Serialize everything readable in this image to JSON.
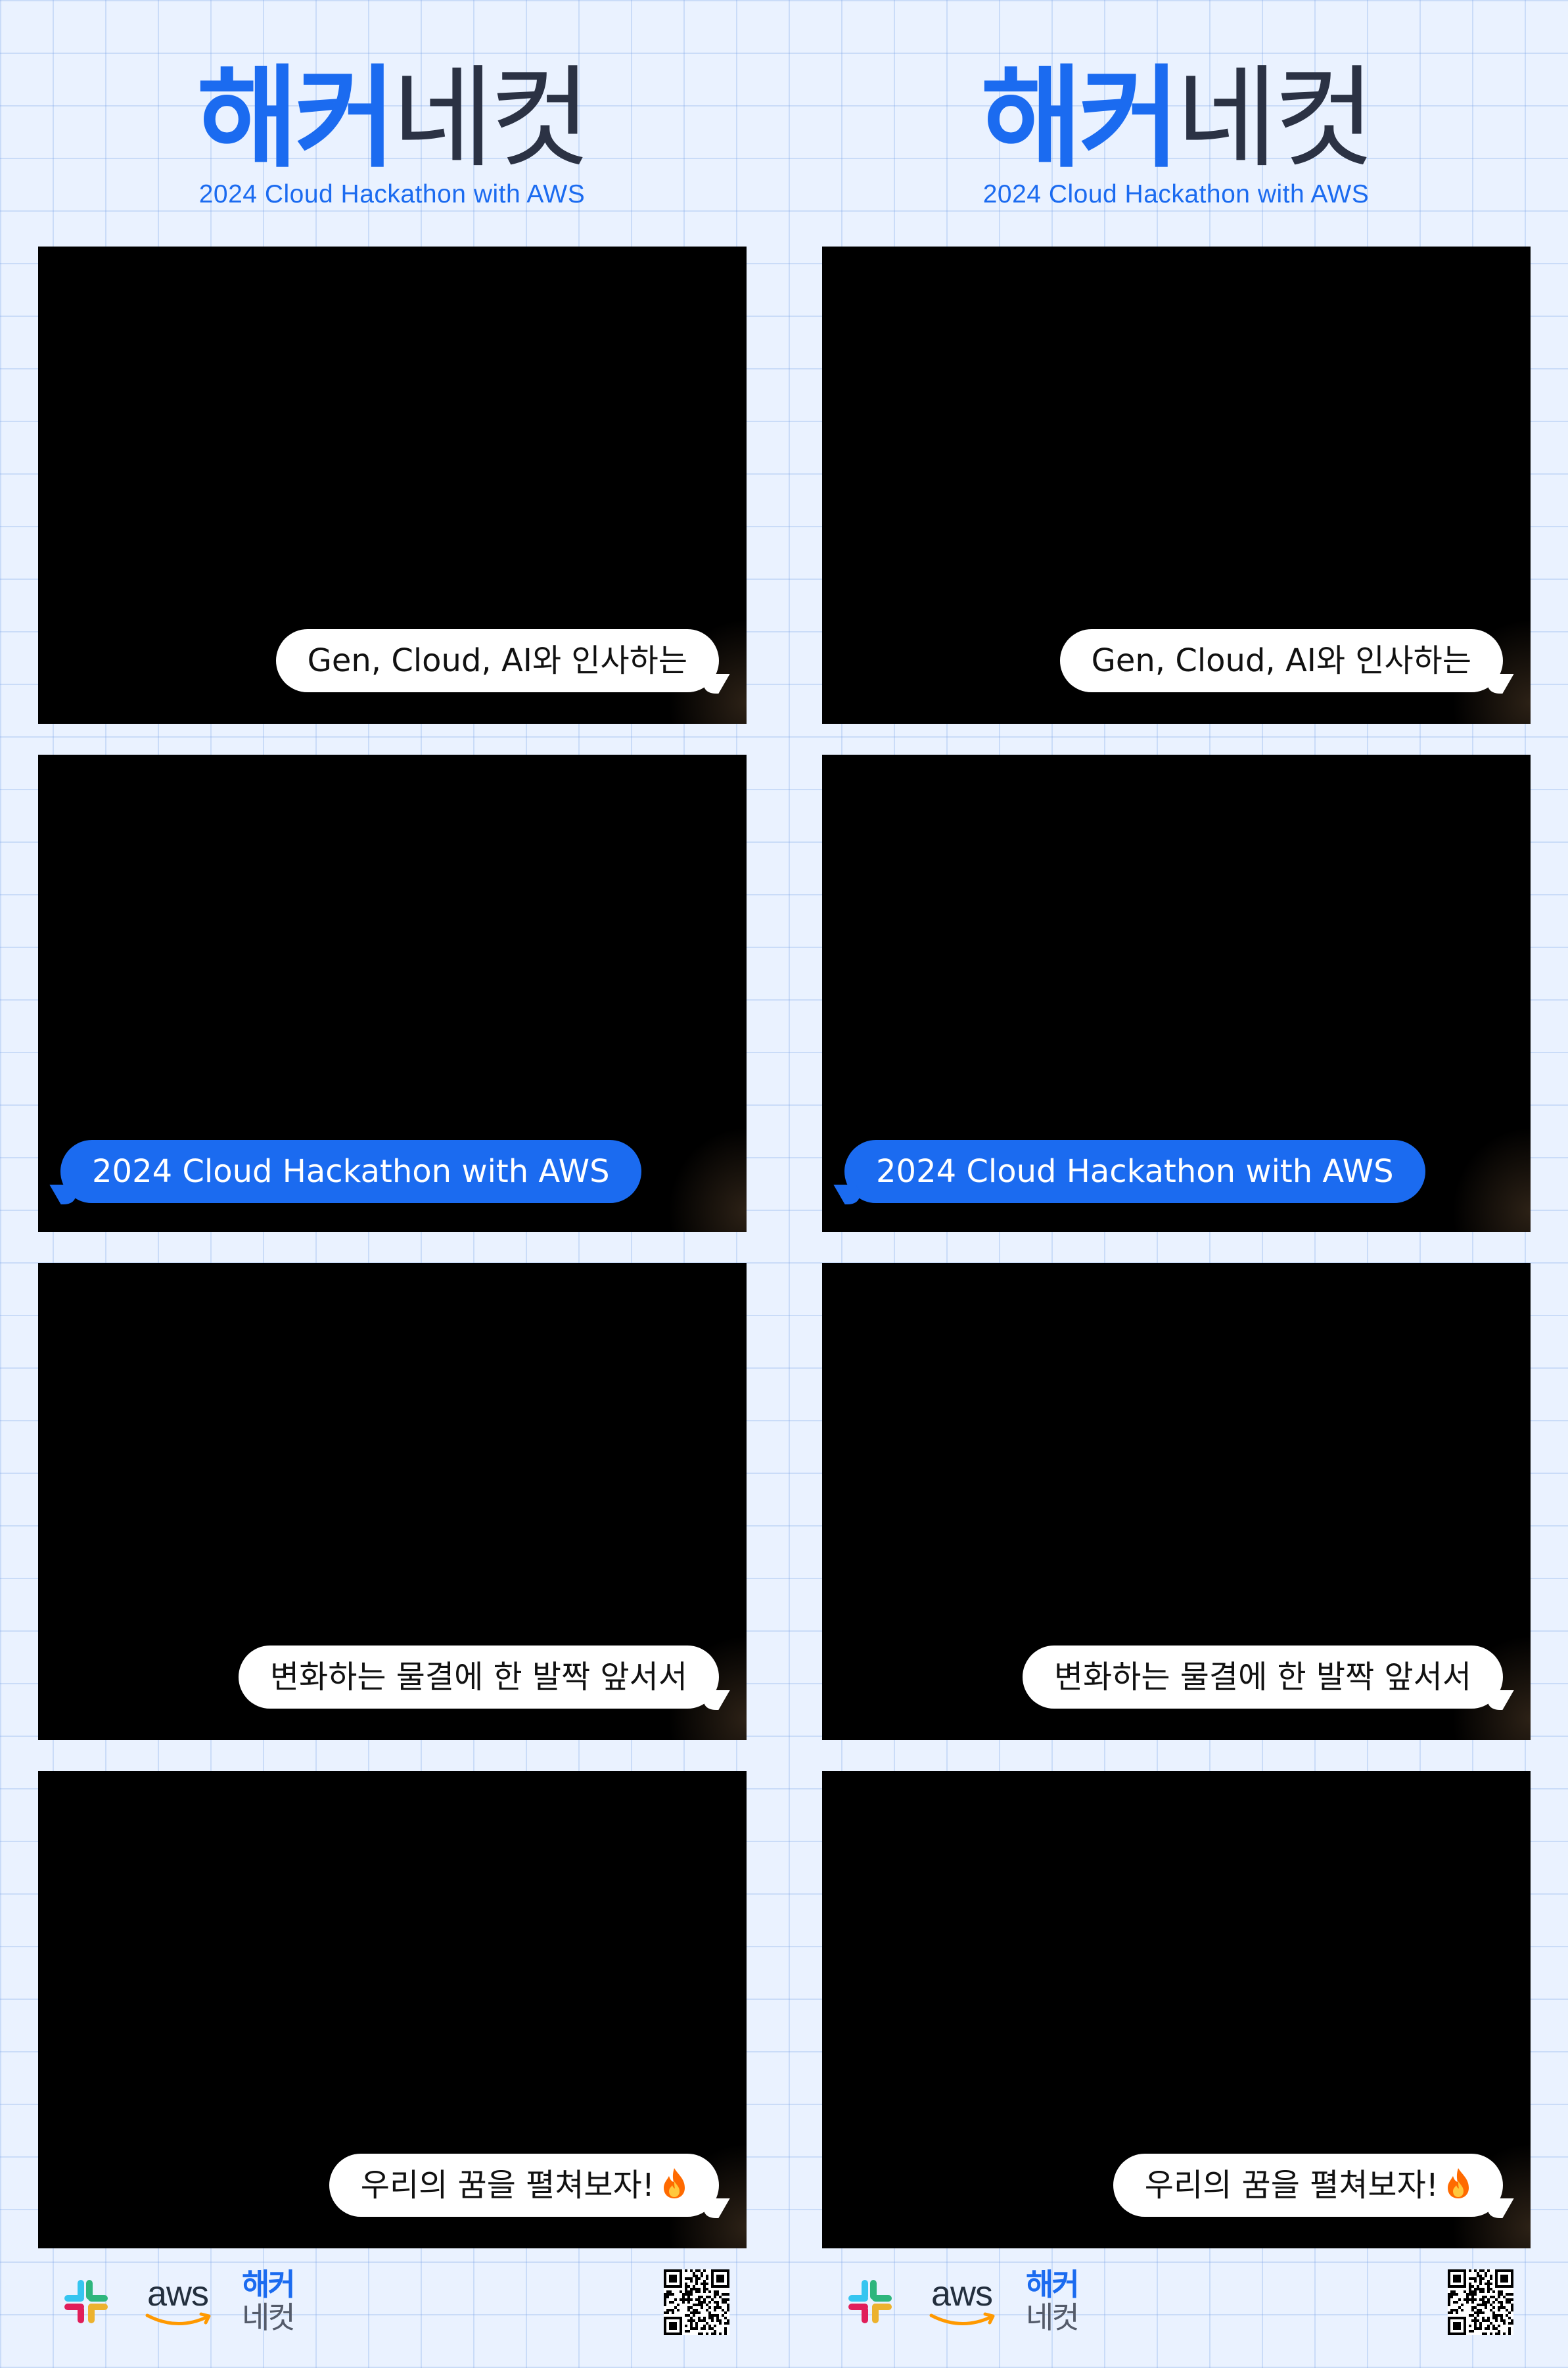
{
  "brand": {
    "title_bold": "해커",
    "title_thin": "네컷",
    "subtitle": "2024 Cloud Hackathon with AWS"
  },
  "frames": [
    {
      "caption": "Gen, Cloud, AI와 인사하는",
      "style": "white"
    },
    {
      "caption": "2024 Cloud Hackathon with AWS",
      "style": "blue"
    },
    {
      "caption": "변화하는 물결에 한 발짝 앞서서",
      "style": "white"
    },
    {
      "caption": "우리의 꿈을 펼쳐보자!",
      "style": "white",
      "icon": "fire-icon"
    }
  ],
  "footer": {
    "logos": [
      "slack-logo",
      "aws-logo",
      "hacker-necut-logo",
      "qr-code"
    ],
    "aws_text": "aws",
    "mini_bold": "해커",
    "mini_thin": "네컷"
  },
  "colors": {
    "accent": "#1b6bf0",
    "background": "#eaf2ff",
    "frame": "#000000",
    "bubble_white": "#ffffff",
    "aws_orange": "#ff9900",
    "slack_blue": "#36c5f0",
    "slack_green": "#2eb67d",
    "slack_yellow": "#ecb22e",
    "slack_red": "#e01e5a",
    "fire_orange": "#ff6a00"
  }
}
